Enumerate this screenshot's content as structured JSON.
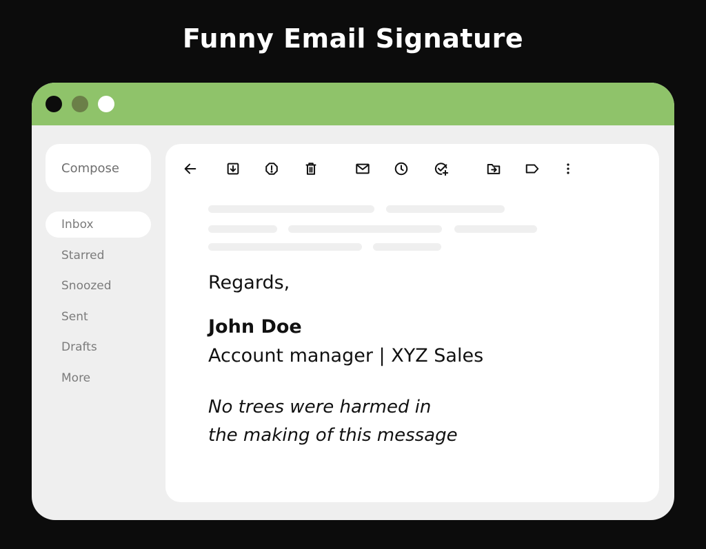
{
  "page_title": "Funny Email Signature",
  "window": {
    "titlebar_color": "#8fc36a",
    "traffic_lights": [
      "#0c0c0c",
      "#6b7f48",
      "#ffffff"
    ]
  },
  "sidebar": {
    "compose_label": "Compose",
    "items": [
      {
        "label": "Inbox",
        "active": true
      },
      {
        "label": "Starred",
        "active": false
      },
      {
        "label": "Snoozed",
        "active": false
      },
      {
        "label": "Sent",
        "active": false
      },
      {
        "label": "Drafts",
        "active": false
      },
      {
        "label": "More",
        "active": false
      }
    ]
  },
  "toolbar": {
    "icons": [
      "back-arrow-icon",
      "archive-icon",
      "report-spam-icon",
      "delete-icon",
      "mark-unread-icon",
      "snooze-icon",
      "add-task-icon",
      "move-to-icon",
      "label-icon",
      "more-options-icon"
    ]
  },
  "message": {
    "closing": "Regards,",
    "sender_name": "John Doe",
    "sender_role": "Account manager | XYZ Sales",
    "quote_line1": "No trees were harmed in",
    "quote_line2": "the making of this message"
  }
}
